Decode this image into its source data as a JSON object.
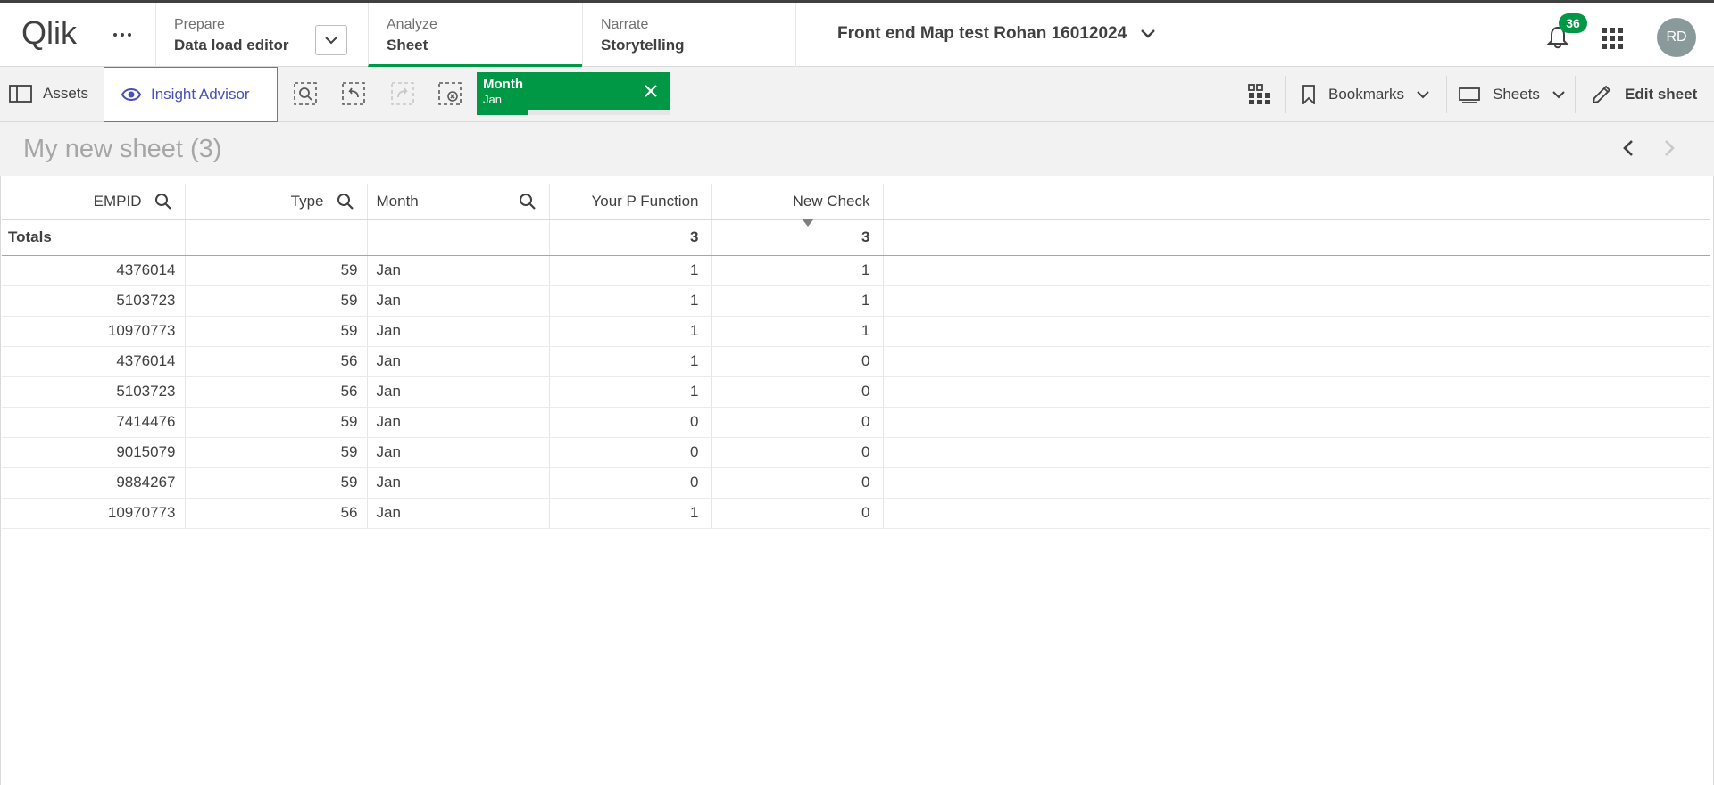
{
  "app": {
    "logo_text": "Qlik",
    "title": "Front end Map test Rohan 16012024",
    "notification_count": "36",
    "user_initials": "RD"
  },
  "nav": {
    "tabs": [
      {
        "sub": "Prepare",
        "main": "Data load editor"
      },
      {
        "sub": "Analyze",
        "main": "Sheet"
      },
      {
        "sub": "Narrate",
        "main": "Storytelling"
      }
    ],
    "active_tab": "Analyze"
  },
  "toolbar": {
    "assets_label": "Assets",
    "insight_label": "Insight Advisor",
    "selection": {
      "field": "Month",
      "value": "Jan",
      "selected_fraction": 0.27
    },
    "bookmarks_label": "Bookmarks",
    "sheets_label": "Sheets",
    "edit_label": "Edit sheet"
  },
  "sheet": {
    "title": "My new sheet (3)"
  },
  "table": {
    "headers": [
      "EMPID",
      "Type",
      "Month",
      "Your P Function",
      "New Check"
    ],
    "totals": {
      "label": "Totals",
      "your_p": "3",
      "new_check": "3"
    },
    "rows": [
      [
        "4376014",
        "59",
        "Jan",
        "1",
        "1"
      ],
      [
        "5103723",
        "59",
        "Jan",
        "1",
        "1"
      ],
      [
        "10970773",
        "59",
        "Jan",
        "1",
        "1"
      ],
      [
        "4376014",
        "56",
        "Jan",
        "1",
        "0"
      ],
      [
        "5103723",
        "56",
        "Jan",
        "1",
        "0"
      ],
      [
        "7414476",
        "59",
        "Jan",
        "0",
        "0"
      ],
      [
        "9015079",
        "59",
        "Jan",
        "0",
        "0"
      ],
      [
        "9884267",
        "59",
        "Jan",
        "0",
        "0"
      ],
      [
        "10970773",
        "56",
        "Jan",
        "1",
        "0"
      ]
    ]
  },
  "colors": {
    "accent": "#009845",
    "insight": "#4a4fbd",
    "text": "#404040"
  }
}
